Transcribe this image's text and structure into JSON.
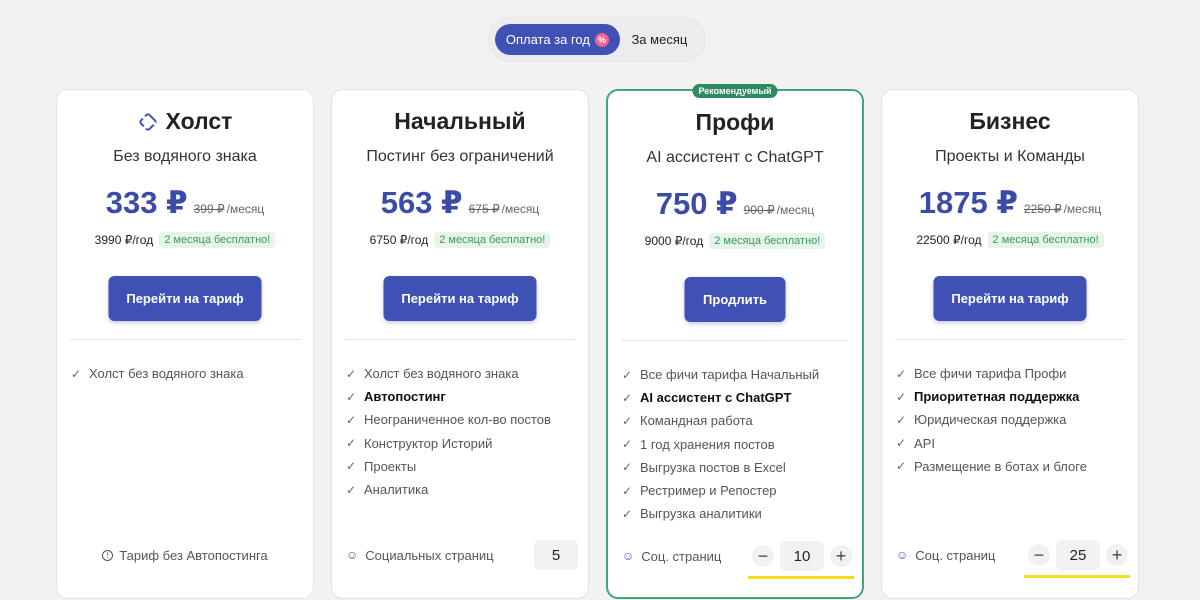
{
  "billing_toggle": {
    "yearly_label": "Оплата за год",
    "yearly_badge": "%",
    "monthly_label": "За месяц"
  },
  "colors": {
    "accent": "#3f51b5",
    "price": "#3b4ba8",
    "recommended": "#43a47a",
    "free_badge_bg": "#e7f4ea",
    "highlight": "#f2de1a"
  },
  "plans": [
    {
      "title": "Холст",
      "icon": "refresh-icon",
      "subtitle": "Без водяного знака",
      "price": "333 ₽",
      "old_price": "399 ₽",
      "per": "/месяц",
      "year_price": "3990 ₽/год",
      "free_badge": "2 месяца бесплатно!",
      "cta": "Перейти на тариф",
      "features": [
        "Холст без водяного знака"
      ],
      "footer": "Тариф без Автопостинга"
    },
    {
      "title": "Начальный",
      "subtitle": "Постинг без ограничений",
      "price": "563 ₽",
      "old_price": "675 ₽",
      "per": "/месяц",
      "year_price": "6750 ₽/год",
      "free_badge": "2 месяца бесплатно!",
      "cta": "Перейти на тариф",
      "features": [
        "Холст без водяного знака",
        "Автопостинг",
        "Неограниченное кол-во постов",
        "Конструктор Историй",
        "Проекты",
        "Аналитика"
      ],
      "footer": "Социальных страниц",
      "count": "5"
    },
    {
      "title": "Профи",
      "badge": "Рекомендуемый",
      "subtitle": "AI ассистент с ChatGPT",
      "price": "750 ₽",
      "old_price": "900 ₽",
      "per": "/месяц",
      "year_price": "9000 ₽/год",
      "free_badge": "2 месяца бесплатно!",
      "cta": "Продлить",
      "features": [
        "Все фичи тарифа Начальный",
        "AI ассистент с ChatGPT",
        "Командная работа",
        "1 год хранения постов",
        "Выгрузка постов в Excel",
        "Рестример и Репостер",
        "Выгрузка аналитики"
      ],
      "footer": "Соц. страниц",
      "count": "10",
      "minus": "−",
      "plus": "+"
    },
    {
      "title": "Бизнес",
      "subtitle": "Проекты и Команды",
      "price": "1875 ₽",
      "old_price": "2250 ₽",
      "per": "/месяц",
      "year_price": "22500 ₽/год",
      "free_badge": "2 месяца бесплатно!",
      "cta": "Перейти на тариф",
      "features": [
        "Все фичи тарифа Профи",
        "Приоритетная поддержка",
        "Юридическая поддержка",
        "API",
        "Размещение в ботах и блоге"
      ],
      "footer": "Соц. страниц",
      "count": "25",
      "minus": "−",
      "plus": "+"
    }
  ]
}
